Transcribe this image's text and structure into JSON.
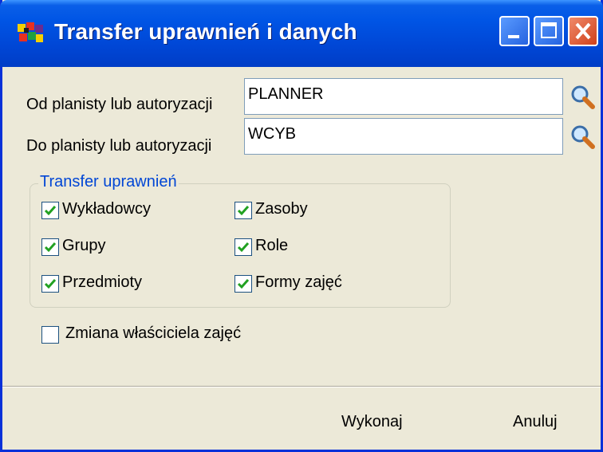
{
  "window": {
    "title": "Transfer uprawnień i danych",
    "app_icon": "scheduler-app-icon",
    "controls": [
      "minimize-icon",
      "maximize-icon",
      "close-icon"
    ],
    "accent_color": "#0054e3"
  },
  "form": {
    "from_label": "Od planisty lub autoryzacji",
    "from_value": "PLANNER",
    "to_label": "Do planisty lub autoryzacji",
    "to_value": "WCYB",
    "lookup_icon": "magnifier-icon"
  },
  "transfer_group": {
    "legend": "Transfer uprawnień",
    "items": [
      {
        "label": "Wykładowcy",
        "checked": true
      },
      {
        "label": "Zasoby",
        "checked": true
      },
      {
        "label": "Grupy",
        "checked": true
      },
      {
        "label": "Role",
        "checked": true
      },
      {
        "label": "Przedmioty",
        "checked": true
      },
      {
        "label": "Formy zajęć",
        "checked": true
      }
    ]
  },
  "owner_change": {
    "label": "Zmiana właściciela zajęć",
    "checked": false
  },
  "buttons": {
    "execute": "Wykonaj",
    "cancel": "Anuluj"
  }
}
